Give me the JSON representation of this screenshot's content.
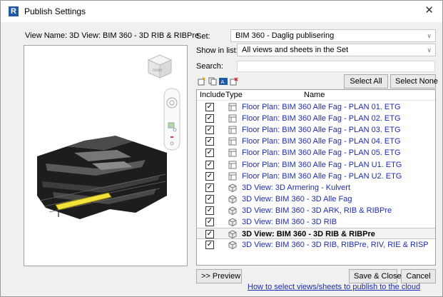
{
  "window": {
    "app_icon": "revit-icon",
    "app_icon_letter": "R",
    "title": "Publish Settings",
    "close_glyph": "✕"
  },
  "left_panel": {
    "view_name_label": "View Name: 3D View: BIM 360 - 3D RIB & RIBPre"
  },
  "set": {
    "label": "Set:",
    "value": "BIM 360 - Daglig publisering"
  },
  "show_in_list": {
    "label": "Show in list:",
    "value": "All views and sheets in the Set"
  },
  "search": {
    "label": "Search:",
    "value": ""
  },
  "toolbar": {
    "icons": [
      "new-set-icon",
      "duplicate-set-icon",
      "rename-set-icon",
      "delete-set-icon"
    ],
    "select_all": "Select All",
    "select_none": "Select None"
  },
  "list": {
    "columns": [
      "Include",
      "Type",
      "Name"
    ],
    "rows": [
      {
        "include": true,
        "type": "sheet-icon",
        "name": "Floor Plan: BIM 360 Alle Fag - PLAN 01. ETG",
        "selected": false
      },
      {
        "include": true,
        "type": "sheet-icon",
        "name": "Floor Plan: BIM 360 Alle Fag - PLAN 02. ETG",
        "selected": false
      },
      {
        "include": true,
        "type": "sheet-icon",
        "name": "Floor Plan: BIM 360 Alle Fag - PLAN 03. ETG",
        "selected": false
      },
      {
        "include": true,
        "type": "sheet-icon",
        "name": "Floor Plan: BIM 360 Alle Fag - PLAN 04. ETG",
        "selected": false
      },
      {
        "include": true,
        "type": "sheet-icon",
        "name": "Floor Plan: BIM 360 Alle Fag - PLAN 05. ETG",
        "selected": false
      },
      {
        "include": true,
        "type": "sheet-icon",
        "name": "Floor Plan: BIM 360 Alle Fag - PLAN U1. ETG",
        "selected": false
      },
      {
        "include": true,
        "type": "sheet-icon",
        "name": "Floor Plan: BIM 360 Alle Fag - PLAN U2. ETG",
        "selected": false
      },
      {
        "include": true,
        "type": "3d-view-icon",
        "name": "3D View: 3D Armering - Kulvert",
        "selected": false
      },
      {
        "include": true,
        "type": "3d-view-icon",
        "name": "3D View: BIM 360 - 3D Alle Fag",
        "selected": false
      },
      {
        "include": true,
        "type": "3d-view-icon",
        "name": "3D View: BIM 360 - 3D ARK, RIB & RIBPre",
        "selected": false
      },
      {
        "include": true,
        "type": "3d-view-icon",
        "name": "3D View: BIM 360 - 3D RIB",
        "selected": false
      },
      {
        "include": true,
        "type": "3d-view-icon",
        "name": "3D View: BIM 360 - 3D RIB & RIBPre",
        "selected": true
      },
      {
        "include": true,
        "type": "3d-view-icon",
        "name": "3D View: BIM 360 - 3D RIB, RIBPre, RIV, RIE & RISP",
        "selected": false
      }
    ]
  },
  "footer": {
    "preview": ">> Preview",
    "save_close": "Save & Close",
    "cancel": "Cancel",
    "help_link": "How to select views/sheets to publish to the cloud"
  },
  "colors": {
    "link_blue": "#1c2bb3",
    "model_highlight": "#f2e23a",
    "revit_blue": "#1f5aa6"
  }
}
